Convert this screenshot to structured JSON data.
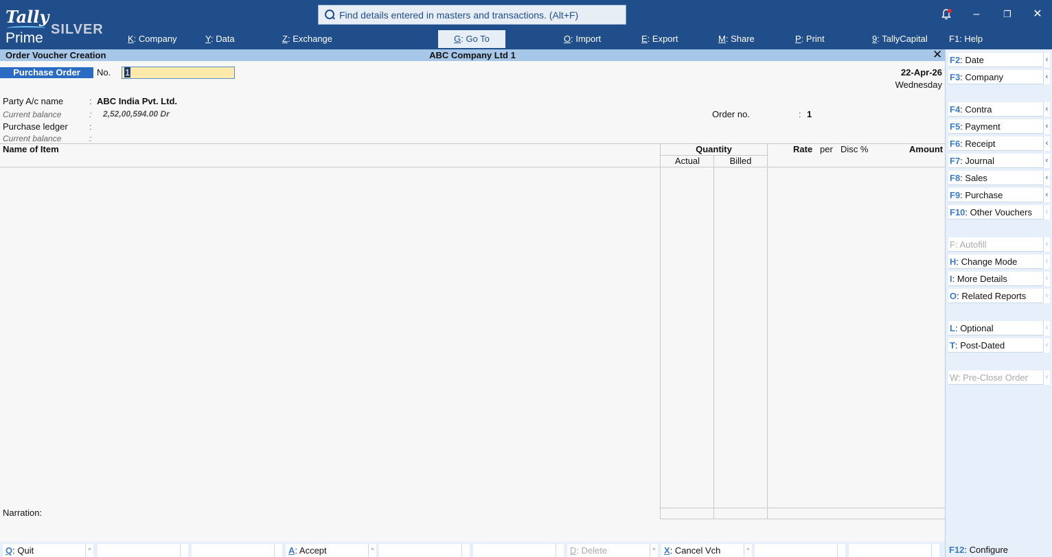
{
  "logo": {
    "tally": "Tally",
    "prime": "Prime",
    "edition": "SILVER"
  },
  "search": {
    "placeholder": "Find details entered in masters and transactions. (Alt+F)"
  },
  "menu": [
    {
      "key": "K",
      "label": "Company"
    },
    {
      "key": "Y",
      "label": "Data"
    },
    {
      "key": "Z",
      "label": "Exchange"
    },
    {
      "key": "G",
      "label": "Go To"
    },
    {
      "key": "O",
      "label": "Import"
    },
    {
      "key": "E",
      "label": "Export"
    },
    {
      "key": "M",
      "label": "Share"
    },
    {
      "key": "P",
      "label": "Print"
    },
    {
      "key": "9",
      "label": "TallyCapital"
    },
    {
      "key": "F1",
      "label": "Help"
    }
  ],
  "title": {
    "screen": "Order Voucher Creation",
    "company": "ABC Company Ltd 1"
  },
  "voucher": {
    "type": "Purchase Order",
    "no_label": "No.",
    "no_value": "1",
    "date": "22-Apr-26",
    "weekday": "Wednesday",
    "party_label": "Party A/c name",
    "party_value": "ABC India Pvt. Ltd.",
    "current_balance_label": "Current balance",
    "party_balance": "2,52,00,594.00 Dr",
    "purchase_ledger_label": "Purchase ledger",
    "order_no_label": "Order no.",
    "order_no_value": "1",
    "colon": ":"
  },
  "table": {
    "name_of_item": "Name of Item",
    "quantity": "Quantity",
    "actual": "Actual",
    "billed": "Billed",
    "rate": "Rate",
    "per": "per",
    "disc": "Disc %",
    "amount": "Amount"
  },
  "narration_label": "Narration:",
  "right_panel": [
    {
      "key": "F2",
      "label": "Date"
    },
    {
      "key": "F3",
      "label": "Company"
    },
    {
      "key": "F4",
      "label": "Contra"
    },
    {
      "key": "F5",
      "label": "Payment"
    },
    {
      "key": "F6",
      "label": "Receipt"
    },
    {
      "key": "F7",
      "label": "Journal"
    },
    {
      "key": "F8",
      "label": "Sales"
    },
    {
      "key": "F9",
      "label": "Purchase"
    },
    {
      "key": "F10",
      "label": "Other Vouchers"
    },
    {
      "key": "F",
      "label": "Autofill"
    },
    {
      "key": "H",
      "label": "Change Mode"
    },
    {
      "key": "I",
      "label": "More Details"
    },
    {
      "key": "O",
      "label": "Related Reports"
    },
    {
      "key": "L",
      "label": "Optional"
    },
    {
      "key": "T",
      "label": "Post-Dated"
    },
    {
      "key": "W",
      "label": "Pre-Close Order"
    }
  ],
  "bottom_bar": [
    {
      "key": "Q",
      "label": "Quit"
    },
    {
      "key": "A",
      "label": "Accept"
    },
    {
      "key": "D",
      "label": "Delete"
    },
    {
      "key": "X",
      "label": "Cancel Vch"
    }
  ],
  "configure": {
    "key": "F12",
    "label": "Configure"
  },
  "icons": {
    "search": "search-icon",
    "bell": "bell-icon",
    "minimize": "minimize-icon",
    "restore": "restore-icon",
    "close": "close-icon",
    "chevron": "chevron-left-icon"
  },
  "colors": {
    "header": "#1f4e8a",
    "title_bar": "#a6c7e8",
    "voucher_type": "#2a6cc4",
    "input_highlight": "#fde9a9",
    "hotkey": "#3a7bc6",
    "notification": "#e02a2a"
  }
}
